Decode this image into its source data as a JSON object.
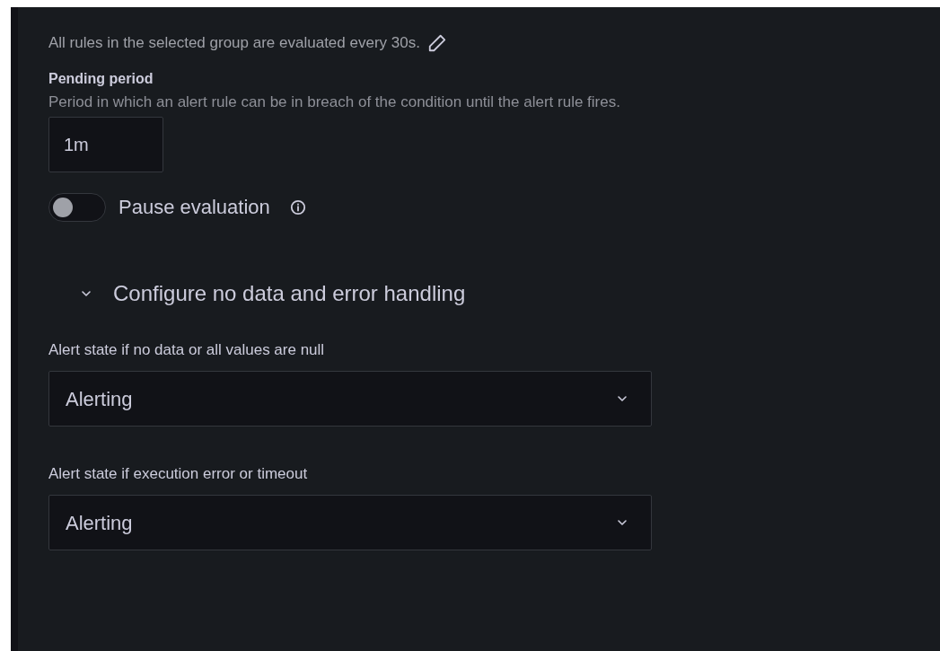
{
  "evaluation_note": "All rules in the selected group are evaluated every 30s.",
  "pending_period": {
    "label": "Pending period",
    "description": "Period in which an alert rule can be in breach of the condition until the alert rule fires.",
    "value": "1m"
  },
  "pause_evaluation": {
    "label": "Pause evaluation",
    "on": false
  },
  "error_handling": {
    "title": "Configure no data and error handling",
    "expanded": true,
    "fields": [
      {
        "label": "Alert state if no data or all values are null",
        "value": "Alerting"
      },
      {
        "label": "Alert state if execution error or timeout",
        "value": "Alerting"
      }
    ]
  }
}
